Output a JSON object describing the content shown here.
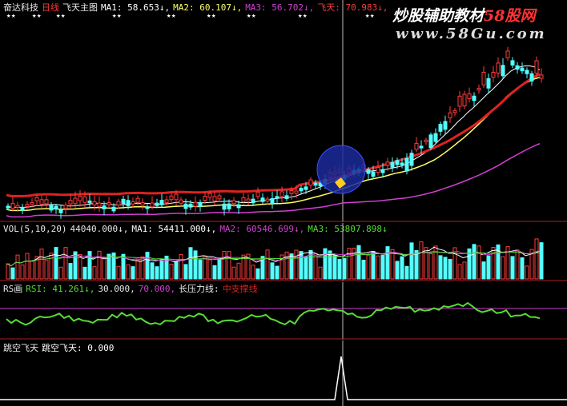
{
  "colors": {
    "bg": "#000000",
    "up": "#ff3b3b",
    "down": "#54ffff",
    "white": "#ffffff",
    "yellow": "#ffff66",
    "magenta": "#d040d0",
    "green": "#55dd33",
    "red": "#dd2222",
    "divider": "#aa2020",
    "title": "#e8e8e8"
  },
  "icons": {
    "star": "★"
  },
  "main": {
    "name": "奋达科技",
    "period": "日线",
    "indicator": "飞天主图",
    "ma1": "MA1: 58.653↓,",
    "ma2": "MA2: 60.107↓,",
    "ma3": "MA3: 56.702↓,",
    "feitian": "飞天: 70.983↓,"
  },
  "watermark": {
    "title": "炒股辅助教材",
    "site": "58股网",
    "url": "www.58Gu.com"
  },
  "vol": {
    "label": "VOL(5,10,20)",
    "value": "44040.000↓,",
    "ma1": "MA1: 54411.000↓,",
    "ma2": "MA2: 60546.699↓,",
    "ma3": "MA3: 53807.898↓"
  },
  "rsi": {
    "label": "RS画",
    "rsi": "RSI: 41.261↓,",
    "v30": "30.000,",
    "v70": "70.000,",
    "pressure": "长压力线:",
    "status": "中支撑线"
  },
  "jump": {
    "label": "跳空飞天",
    "value": "跳空飞天: 0.000"
  }
}
